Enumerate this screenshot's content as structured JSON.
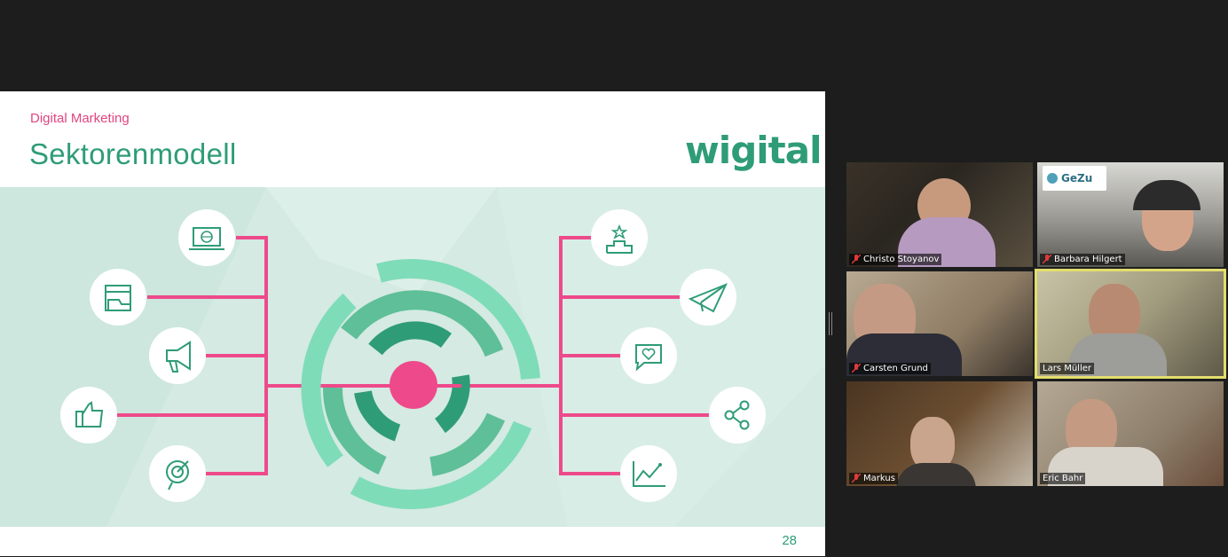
{
  "slide": {
    "subtitle": "Digital Marketing",
    "title": "Sektorenmodell",
    "logo": "wigital",
    "page_number": "28"
  },
  "colors": {
    "pink": "#ee4a8b",
    "green_dark": "#2f9c78",
    "green_mid": "#5fbf98",
    "green_light": "#7fdcb8",
    "diagram_bg": "#d4eae3"
  },
  "diagram": {
    "left_icons": [
      "laptop-globe-icon",
      "folder-window-icon",
      "megaphone-icon",
      "thumbs-up-icon",
      "target-icon"
    ],
    "right_icons": [
      "podium-star-icon",
      "paper-plane-icon",
      "chat-heart-icon",
      "share-icon",
      "line-chart-icon"
    ]
  },
  "participants": [
    {
      "name": "Christo Stoyanov",
      "muted": true,
      "active": false
    },
    {
      "name": "Barbara Hilgert",
      "muted": true,
      "active": false,
      "logo": "GeZu"
    },
    {
      "name": "Carsten Grund",
      "muted": true,
      "active": false
    },
    {
      "name": "Lars Müller",
      "muted": false,
      "active": true
    },
    {
      "name": "Markus",
      "muted": true,
      "active": false
    },
    {
      "name": "Eric Bahr",
      "muted": false,
      "active": false
    }
  ]
}
